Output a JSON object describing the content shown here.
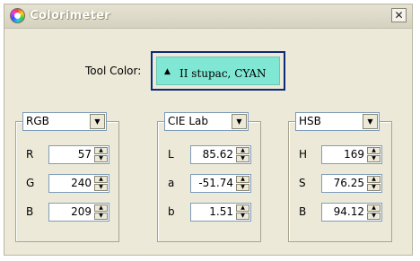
{
  "window": {
    "title": "Colorimeter",
    "close_glyph": "✕",
    "icon": "color-wheel-icon"
  },
  "tool": {
    "label": "Tool Color:",
    "value": "II stupac, CYAN",
    "marker": "▲",
    "swatch_color": "#7fe7d3"
  },
  "groups": [
    {
      "mode": "RGB",
      "rows": [
        {
          "label": "R",
          "value": "57"
        },
        {
          "label": "G",
          "value": "240"
        },
        {
          "label": "B",
          "value": "209"
        }
      ]
    },
    {
      "mode": "CIE Lab",
      "rows": [
        {
          "label": "L",
          "value": "85.62"
        },
        {
          "label": "a",
          "value": "-51.74"
        },
        {
          "label": "b",
          "value": "1.51"
        }
      ]
    },
    {
      "mode": "HSB",
      "rows": [
        {
          "label": "H",
          "value": "169"
        },
        {
          "label": "S",
          "value": "76.25"
        },
        {
          "label": "B",
          "value": "94.12"
        }
      ]
    }
  ],
  "glyphs": {
    "dropdown": "▼",
    "spin_up": "▲",
    "spin_down": "▼"
  }
}
